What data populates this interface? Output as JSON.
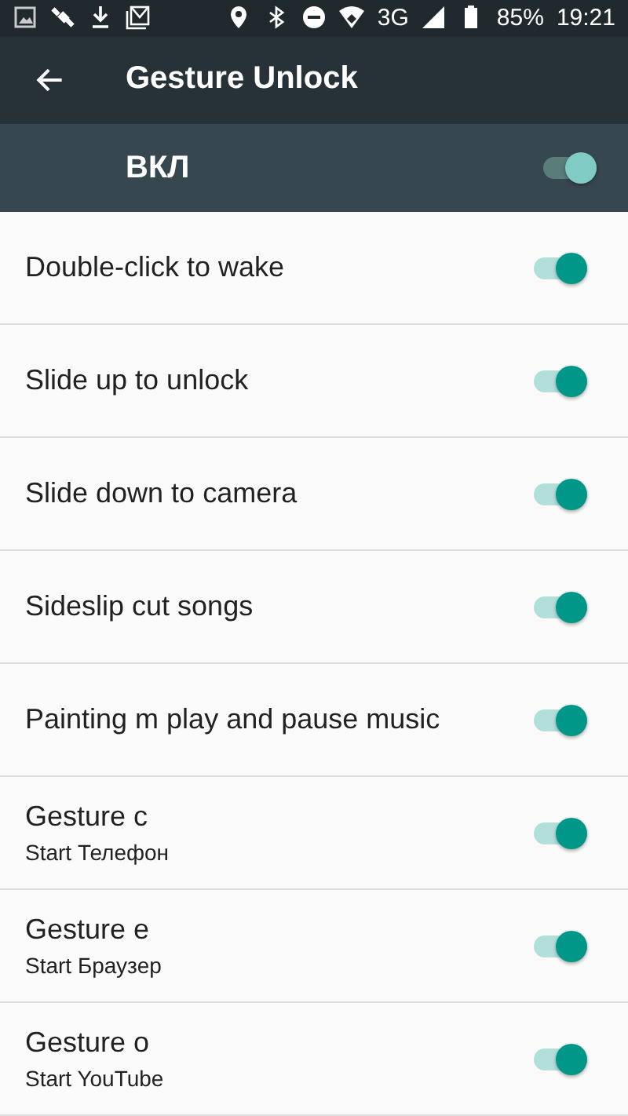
{
  "status_bar": {
    "network": "3G",
    "battery": "85%",
    "time": "19:21"
  },
  "app_bar": {
    "title": "Gesture Unlock"
  },
  "master": {
    "label": "ВКЛ",
    "on": true
  },
  "items": [
    {
      "title": "Double-click to wake",
      "on": true
    },
    {
      "title": "Slide up to unlock",
      "on": true
    },
    {
      "title": "Slide down to camera",
      "on": true
    },
    {
      "title": "Sideslip cut songs",
      "on": true
    },
    {
      "title": "Painting m play and pause music",
      "on": true
    },
    {
      "title": "Gesture c",
      "subtitle": "Start Телефон",
      "on": true
    },
    {
      "title": "Gesture e",
      "subtitle": "Start Браузер",
      "on": true
    },
    {
      "title": "Gesture o",
      "subtitle": "Start YouTube",
      "on": true
    }
  ]
}
